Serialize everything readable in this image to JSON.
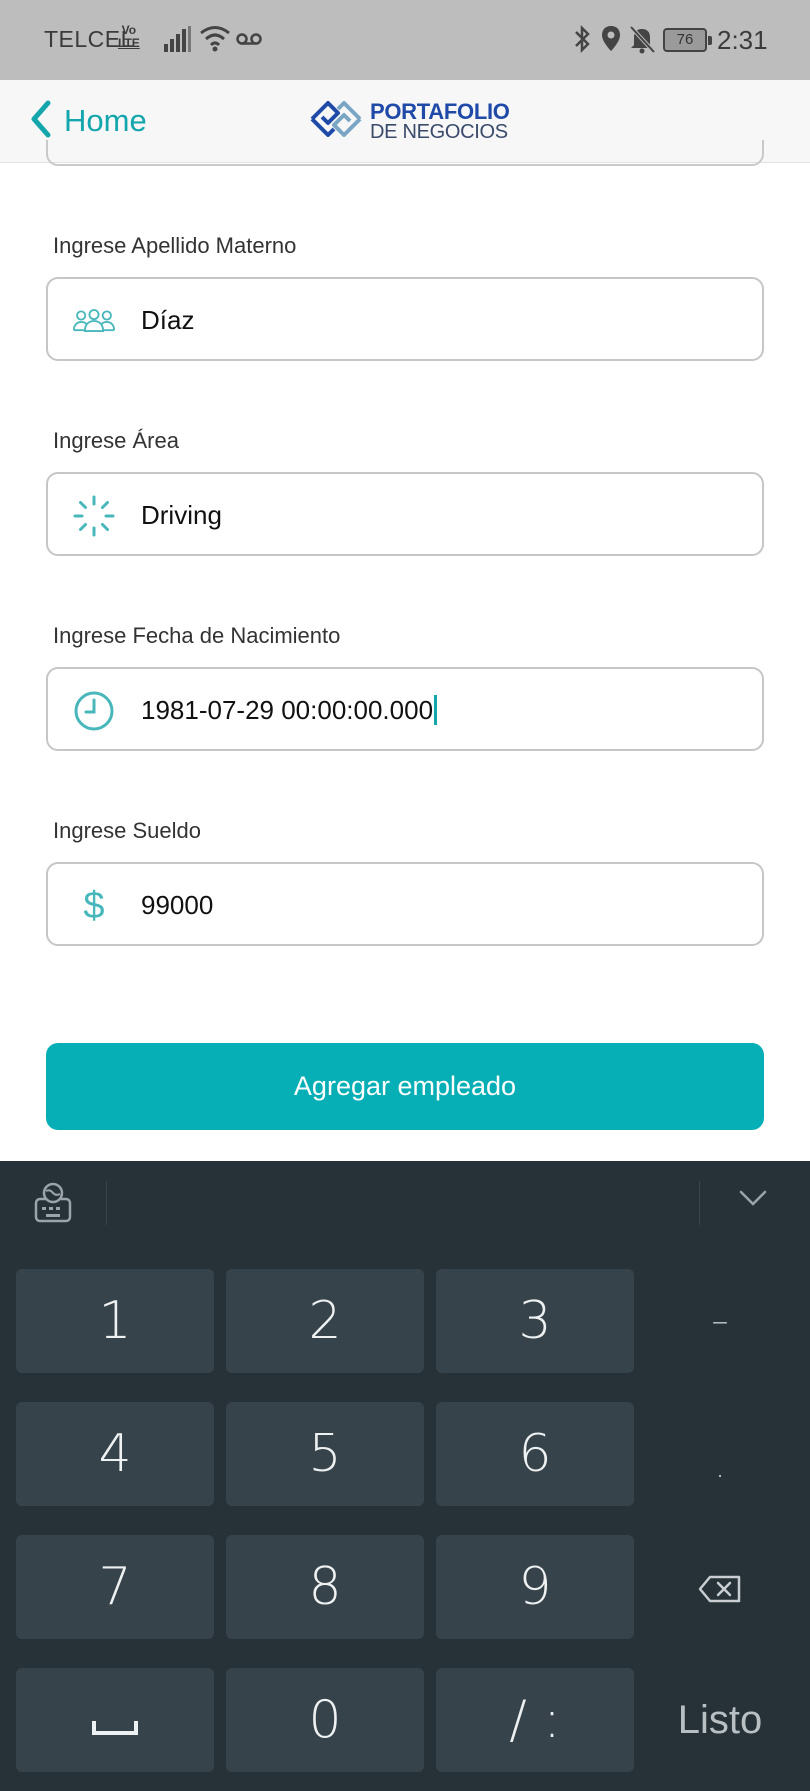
{
  "status_bar": {
    "carrier": "TELCEL",
    "volte_top": "Vo",
    "volte_bottom": "LTE",
    "battery": "76",
    "time": "2:31"
  },
  "nav": {
    "back_label": "Home",
    "logo_line1": "PORTAFOLIO",
    "logo_line2": "DE NEGOCIOS"
  },
  "form": {
    "fields": [
      {
        "label": "Ingrese Apellido Materno",
        "value": "Díaz",
        "icon": "people-icon"
      },
      {
        "label": "Ingrese Área",
        "value": "Driving",
        "icon": "loading-icon"
      },
      {
        "label": "Ingrese Fecha de Nacimiento",
        "value": "1981-07-29 00:00:00.000",
        "icon": "clock-icon"
      },
      {
        "label": "Ingrese Sueldo",
        "value": "99000",
        "icon": "dollar-icon",
        "icon_glyph": "$"
      }
    ],
    "submit_label": "Agregar empleado"
  },
  "keyboard": {
    "keys": [
      "1",
      "2",
      "3",
      "–",
      "4",
      "5",
      "6",
      ".",
      "7",
      "8",
      "9",
      "0",
      "/ :"
    ],
    "done_label": "Listo"
  },
  "colors": {
    "accent": "#06aeb5",
    "keyboard_bg": "#263238",
    "key_bg": "#37434a"
  }
}
